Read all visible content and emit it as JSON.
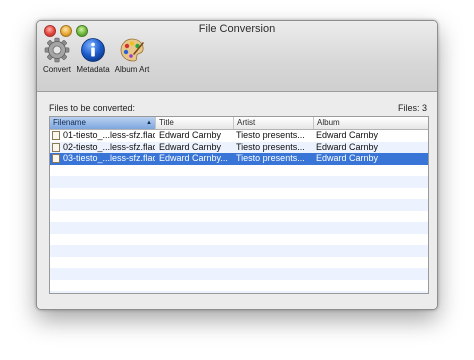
{
  "window": {
    "title": "File Conversion"
  },
  "toolbar": {
    "items": [
      {
        "label": "Convert",
        "icon": "gear-icon"
      },
      {
        "label": "Metadata",
        "icon": "info-icon"
      },
      {
        "label": "Album Art",
        "icon": "palette-icon"
      }
    ]
  },
  "files": {
    "label": "Files to be converted:",
    "count": "Files: 3"
  },
  "table": {
    "columns": [
      "Filename",
      "Title",
      "Artist",
      "Album"
    ],
    "sorted_column": "Filename",
    "rows": [
      {
        "filename": "01-tiesto_...less-sfz.flac",
        "title": "Edward Carnby",
        "artist": "Tiesto presents...",
        "album": "Edward Carnby",
        "selected": false
      },
      {
        "filename": "02-tiesto_...less-sfz.flac",
        "title": "Edward Carnby",
        "artist": "Tiesto presents...",
        "album": "Edward Carnby",
        "selected": false
      },
      {
        "filename": "03-tiesto_...less-sfz.flac",
        "title": "Edward Carnby...",
        "artist": "Tiesto presents...",
        "album": "Edward Carnby",
        "selected": true
      }
    ]
  },
  "buttons": {
    "add": "+",
    "remove": "−"
  },
  "colors": {
    "selection": "#3875d7",
    "alternate_row": "#edf3fe"
  }
}
